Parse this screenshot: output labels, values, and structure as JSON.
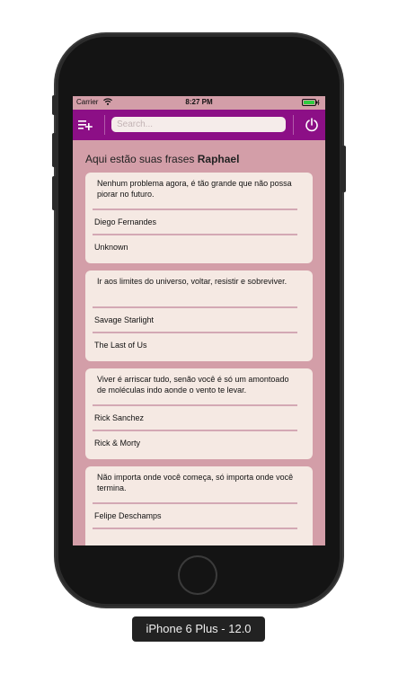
{
  "status_bar": {
    "carrier": "Carrier",
    "time": "8:27 PM"
  },
  "nav": {
    "search_placeholder": "Search..."
  },
  "greeting": {
    "prefix": "Aqui estão suas frases",
    "name": "Raphael"
  },
  "quotes": [
    {
      "text": "Nenhum problema agora, é tão grande que não possa piorar no futuro.",
      "author": "Diego Fernandes",
      "source": "Unknown"
    },
    {
      "text": "Ir aos limites do universo, voltar, resistir e sobreviver.",
      "author": "Savage Starlight",
      "source": "The Last of Us"
    },
    {
      "text": "Viver é arriscar tudo, senão você é só um amontoado de moléculas indo aonde o vento te levar.",
      "author": "Rick Sanchez",
      "source": "Rick & Morty"
    },
    {
      "text": "Não importa onde você começa, só importa onde você termina.",
      "author": "Felipe Deschamps",
      "source": ""
    }
  ],
  "device_label": "iPhone 6 Plus - 12.0",
  "colors": {
    "nav_bar": "#8c0f86",
    "screen_background": "#d39ea8",
    "card_background": "#f5e9e3",
    "card_divider": "#d3a8b4"
  }
}
